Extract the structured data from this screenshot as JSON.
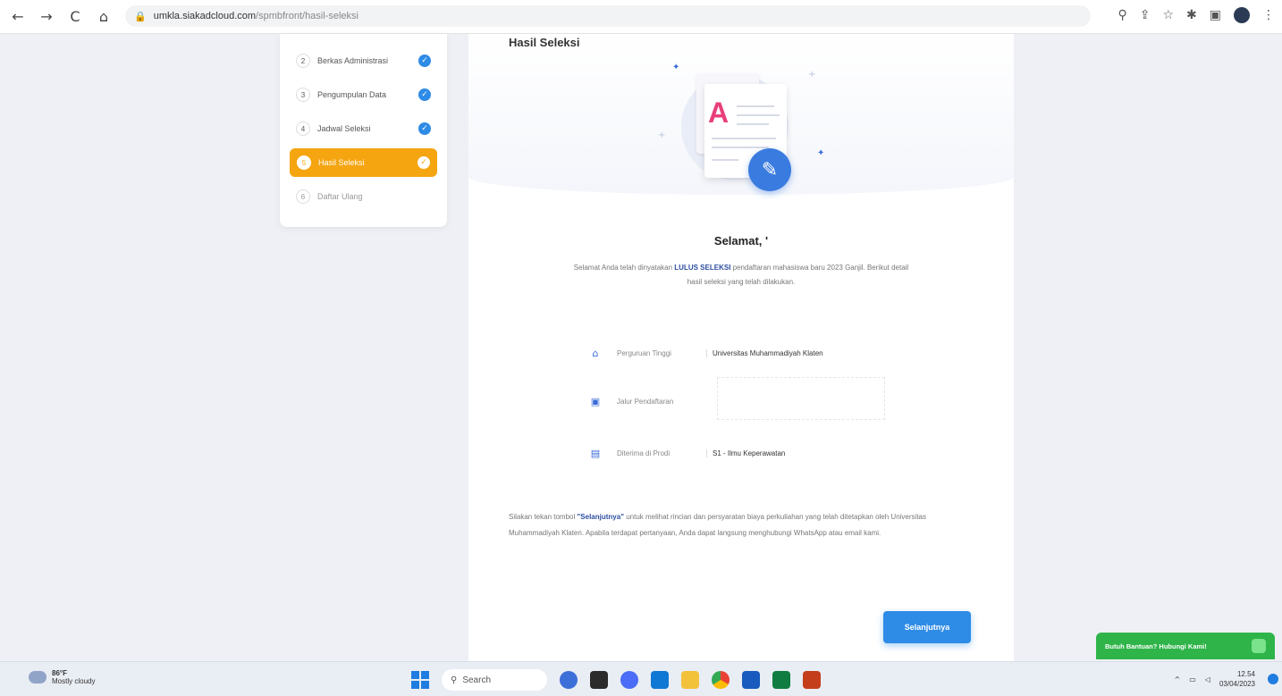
{
  "browser": {
    "url_host": "umkla.siakadcloud.com",
    "url_path": "/spmbfront/hasil-seleksi",
    "back_icon": "←",
    "forward_icon": "→",
    "reload_icon": "C",
    "home_icon": "⌂",
    "lock_icon": "🔒"
  },
  "steps": [
    {
      "num": "2",
      "label": "Berkas Administrasi",
      "state": "done"
    },
    {
      "num": "3",
      "label": "Pengumpulan Data",
      "state": "done"
    },
    {
      "num": "4",
      "label": "Jadwal Seleksi",
      "state": "done"
    },
    {
      "num": "5",
      "label": "Hasil Seleksi",
      "state": "active"
    },
    {
      "num": "6",
      "label": "Daftar Ulang",
      "state": "pending"
    }
  ],
  "card": {
    "title": "Hasil Seleksi",
    "illustration_letter": "A",
    "congrats": "Selamat, '",
    "desc_before": "Selamat Anda telah dinyatakan ",
    "desc_bold": "LULUS SELEKSI",
    "desc_after": " pendaftaran mahasiswa baru 2023 Ganjil. Berikut detail hasil seleksi yang telah dilakukan.",
    "info": [
      {
        "icon": "⌂",
        "label": "Perguruan Tinggi",
        "value": "Universitas Muhammadiyah Klaten"
      },
      {
        "icon": "▣",
        "label": "Jalur Pendaftaran",
        "value": ""
      },
      {
        "icon": "▤",
        "label": "Diterima di Prodi",
        "value": "S1 - Ilmu Keperawatan"
      }
    ],
    "note_before": "Silakan tekan tombol ",
    "note_bold": "\"Selanjutnya\"",
    "note_after": " untuk melihat rincian dan persyaratan biaya perkuliahan yang telah ditetapkan oleh Universitas Muhammadiyah Klaten. Apabila terdapat pertanyaan, Anda dapat langsung menghubungi WhatsApp atau email kami.",
    "next_button": "Selanjutnya"
  },
  "help_chip": "Butuh Bantuan? Hubungi Kami!",
  "taskbar": {
    "temp": "86°F",
    "weather": "Mostly cloudy",
    "search": "Search",
    "time": "12.54",
    "date": "03/04/2023"
  },
  "colors": {
    "accent": "#2e8be6",
    "active_step": "#f5a510",
    "whatsapp": "#2fb44a"
  }
}
